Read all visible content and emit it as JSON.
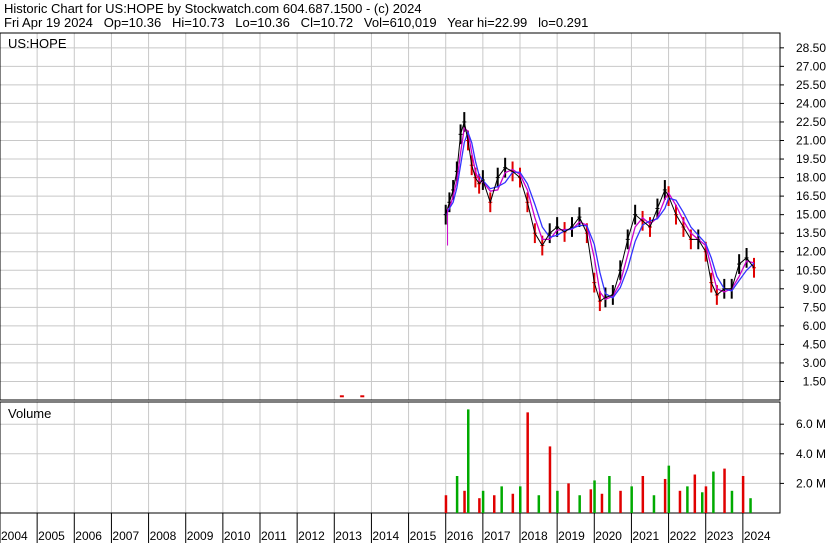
{
  "header": {
    "line1": "Historic Chart for US:HOPE by Stockwatch.com 604.687.1500 - (c) 2024",
    "line2": "Fri Apr 19 2024   Op=10.36   Hi=10.73   Lo=10.36   Cl=10.72   Vol=610,019   Year hi=22.99   lo=0.291"
  },
  "colors": {
    "price_bar": "#000000",
    "down_bar": "#e00000",
    "ma_fast": "#cc00cc",
    "ma_slow": "#3333ff",
    "volume_up": "#00aa00",
    "volume_down": "#e00000",
    "grid": "#c8c8c8"
  },
  "chart_data": [
    {
      "type": "line",
      "panel": "price",
      "title": "US:HOPE",
      "y_ticks": [
        "28.50",
        "27.00",
        "25.50",
        "24.00",
        "22.50",
        "21.00",
        "19.50",
        "18.00",
        "16.50",
        "15.00",
        "13.50",
        "12.00",
        "10.50",
        "9.00",
        "7.50",
        "6.00",
        "4.50",
        "3.00",
        "1.50"
      ],
      "ylim": [
        0,
        29.7
      ],
      "grid": true,
      "series": [
        {
          "x": [
            2016.0,
            2016.1,
            2016.2,
            2016.3,
            2016.4,
            2016.5,
            2016.6,
            2016.7,
            2016.8,
            2016.9,
            2017.0,
            2017.2,
            2017.4,
            2017.6,
            2017.8,
            2018.0,
            2018.2,
            2018.4,
            2018.6,
            2018.8,
            2019.0,
            2019.2,
            2019.4,
            2019.6,
            2019.8,
            2020.0,
            2020.15,
            2020.3,
            2020.5,
            2020.7,
            2020.9,
            2021.1,
            2021.3,
            2021.5,
            2021.7,
            2021.9,
            2022.0,
            2022.2,
            2022.4,
            2022.6,
            2022.8,
            2023.0,
            2023.15,
            2023.3,
            2023.5,
            2023.7,
            2023.9,
            2024.1,
            2024.3
          ],
          "y": [
            15.0,
            16.0,
            17.0,
            18.5,
            21.5,
            22.5,
            21.0,
            19.0,
            18.0,
            17.5,
            17.8,
            16.0,
            18.0,
            18.8,
            18.5,
            18.0,
            16.0,
            13.5,
            12.5,
            13.5,
            14.0,
            13.6,
            14.0,
            14.8,
            13.5,
            9.5,
            8.0,
            8.3,
            8.5,
            10.5,
            13.0,
            15.0,
            14.5,
            14.0,
            15.5,
            17.0,
            16.5,
            15.0,
            14.0,
            13.0,
            13.0,
            12.0,
            9.5,
            8.5,
            9.0,
            9.0,
            11.0,
            11.5,
            10.7
          ]
        }
      ],
      "extra_marks": [
        {
          "x": 2016.05,
          "y": 12.5
        },
        {
          "x": 2013.15,
          "y": 0.3
        },
        {
          "x": 2013.7,
          "y": 0.3
        }
      ]
    },
    {
      "type": "bar",
      "panel": "volume",
      "title": "Volume",
      "y_ticks": [
        "6.0 M",
        "4.0 M",
        "2.0 M"
      ],
      "ylim": [
        0,
        7.5
      ],
      "grid": true,
      "series": [
        {
          "x": [
            2016.0,
            2016.3,
            2016.5,
            2016.6,
            2016.9,
            2017.0,
            2017.3,
            2017.5,
            2017.8,
            2018.0,
            2018.2,
            2018.5,
            2018.8,
            2019.0,
            2019.3,
            2019.6,
            2019.9,
            2020.0,
            2020.2,
            2020.4,
            2020.7,
            2021.0,
            2021.3,
            2021.6,
            2021.9,
            2022.0,
            2022.3,
            2022.5,
            2022.7,
            2022.9,
            2023.0,
            2023.2,
            2023.5,
            2023.7,
            2024.0,
            2024.2
          ],
          "y": [
            1.2,
            2.5,
            1.5,
            7.0,
            1.0,
            1.5,
            1.2,
            1.8,
            1.3,
            1.8,
            6.8,
            1.2,
            4.5,
            1.5,
            2.0,
            1.2,
            1.6,
            2.2,
            1.3,
            2.5,
            1.5,
            1.8,
            2.5,
            1.2,
            2.3,
            3.2,
            1.5,
            1.8,
            2.6,
            1.4,
            1.8,
            2.8,
            3.0,
            1.5,
            2.5,
            1.0
          ]
        }
      ]
    },
    {
      "type": "axis",
      "panel": "x",
      "categories": [
        "2004",
        "2005",
        "2006",
        "2007",
        "2008",
        "2009",
        "2010",
        "2011",
        "2012",
        "2013",
        "2014",
        "2015",
        "2016",
        "2017",
        "2018",
        "2019",
        "2020",
        "2021",
        "2022",
        "2023",
        "2024"
      ]
    }
  ]
}
